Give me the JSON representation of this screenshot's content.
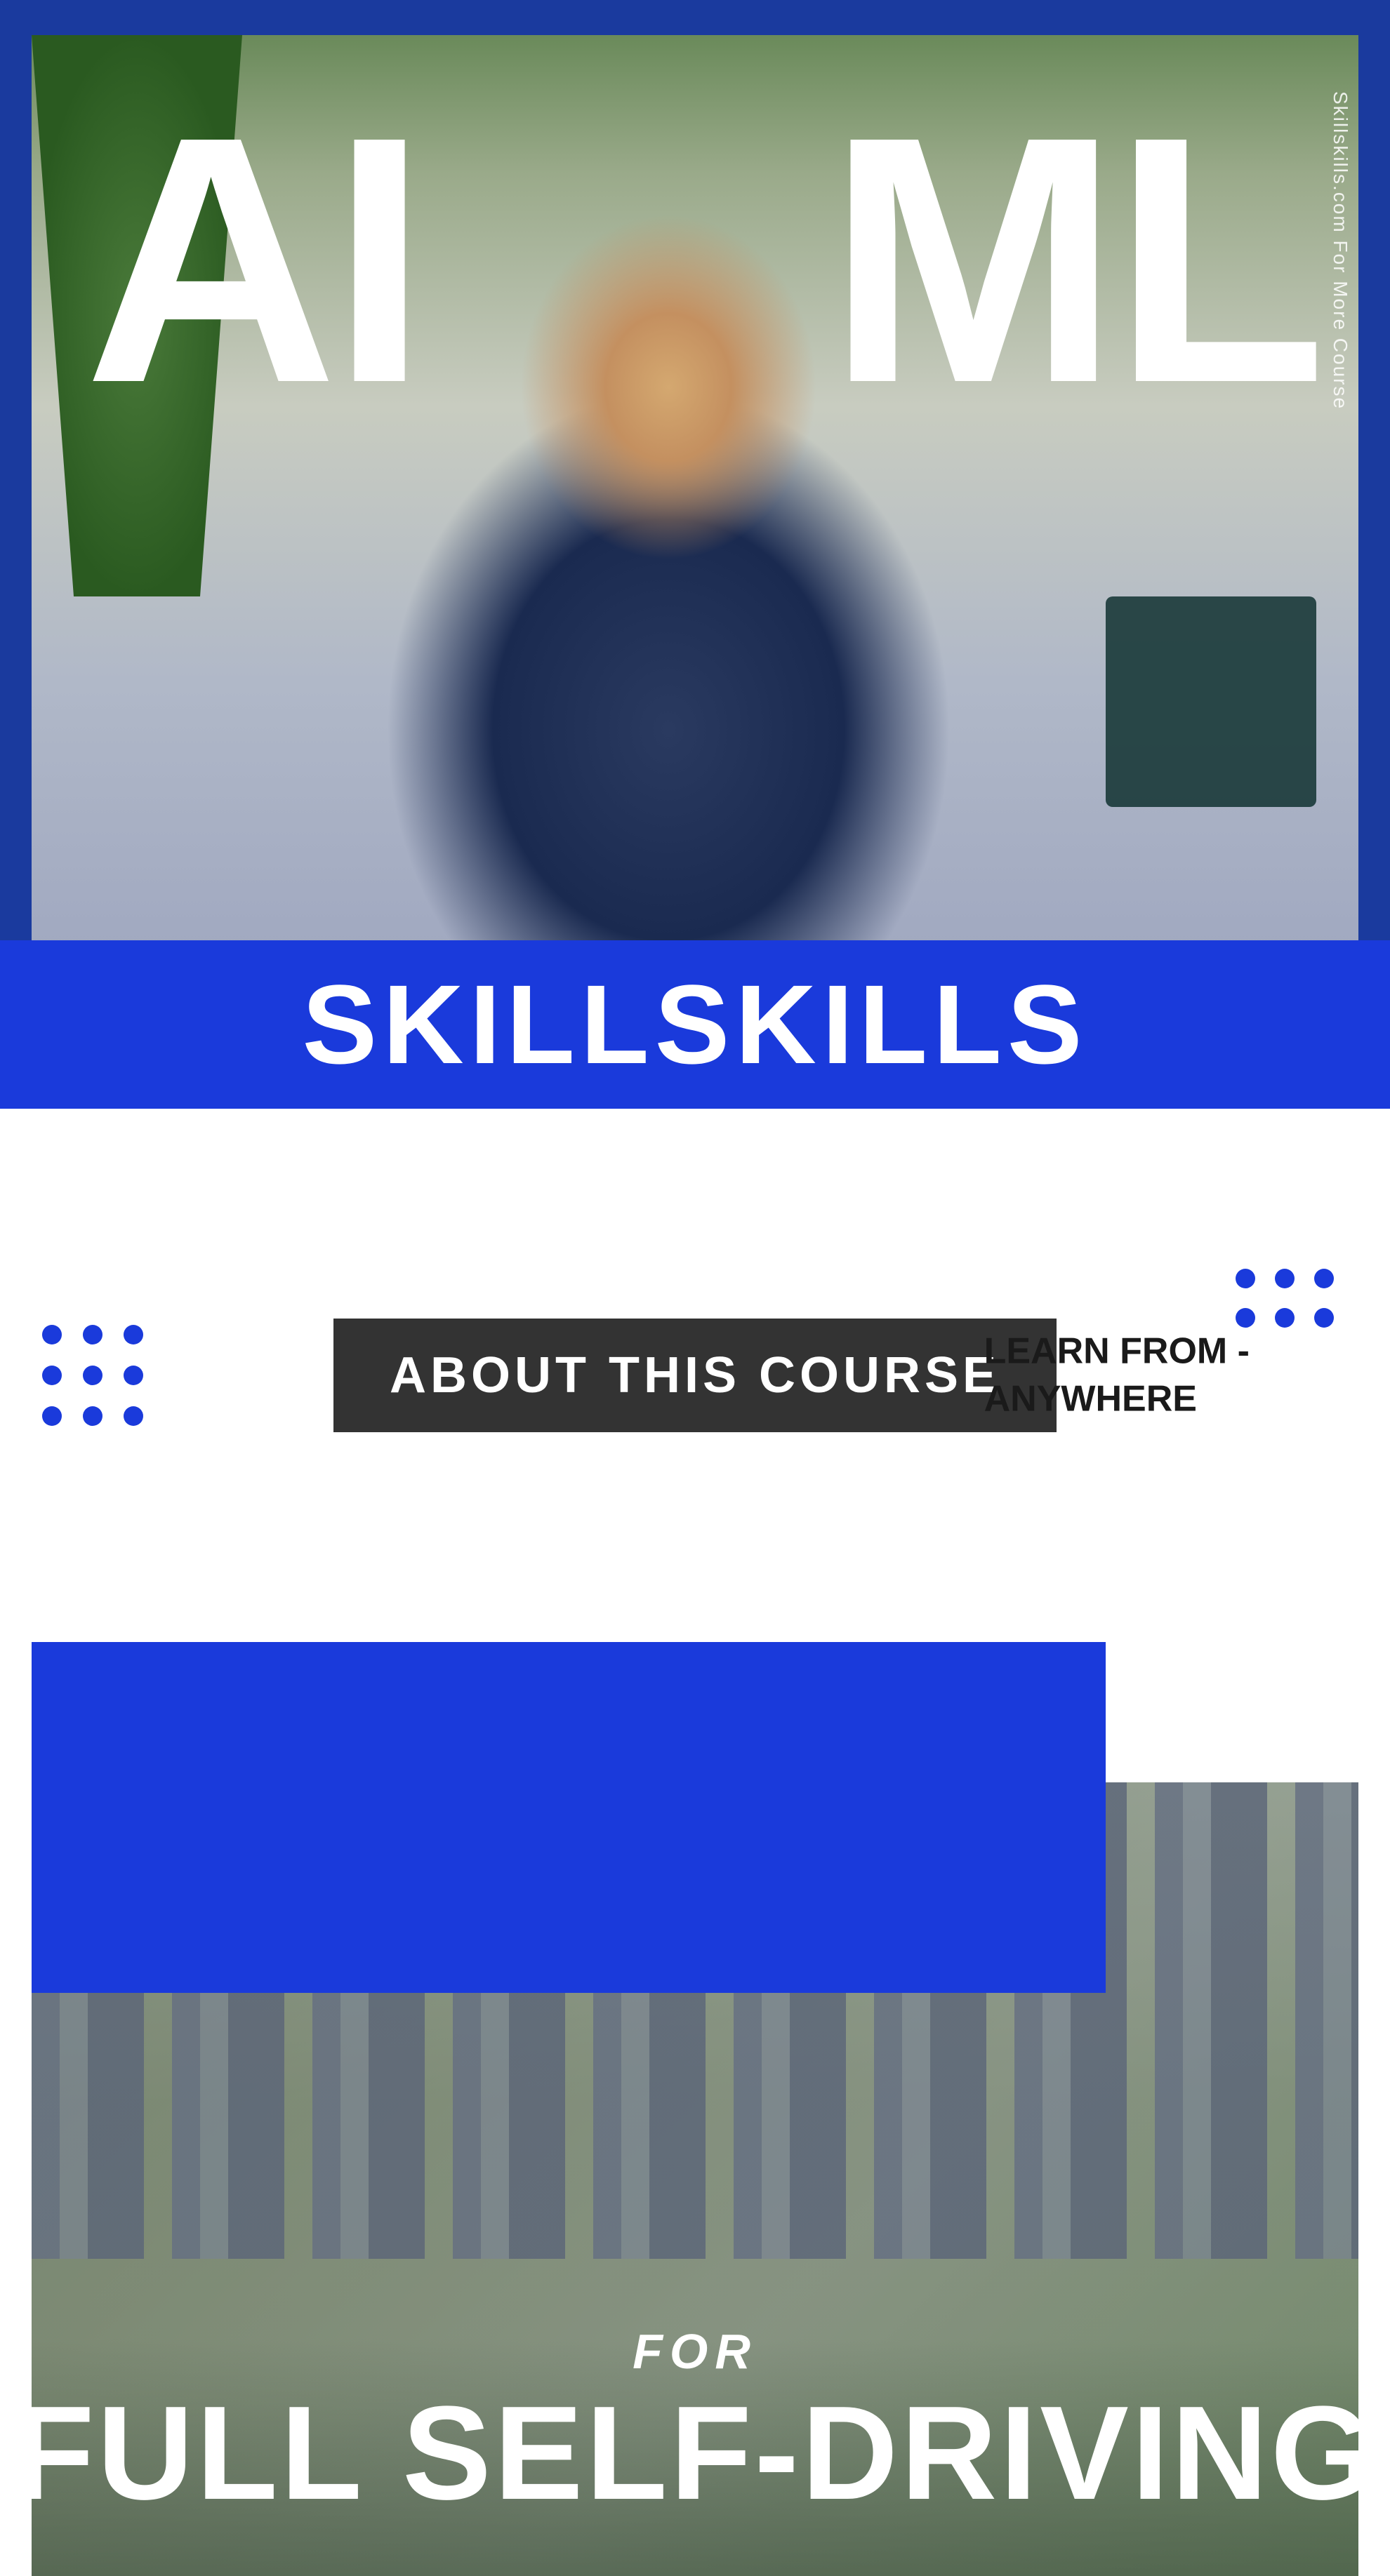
{
  "hero": {
    "title_ai": "AI",
    "title_ml": "ML",
    "brand": "SKILLSKILLS",
    "watermark": "Skillskills.com For More Course"
  },
  "middle": {
    "about_badge": "ABOUT THIS COURSE",
    "learn_from_line1": "LEARN FROM -",
    "learn_from_line2": "ANYWHERE",
    "dots_left_count": 9,
    "dots_right_count": 6
  },
  "selfdriving": {
    "for_label": "FOR",
    "main_title": "FULL SELF-DRIVING"
  },
  "colors": {
    "brand_blue": "#1a3adb",
    "dark_bg": "#333333",
    "white": "#ffffff",
    "text_dark": "#1a1a1a"
  }
}
